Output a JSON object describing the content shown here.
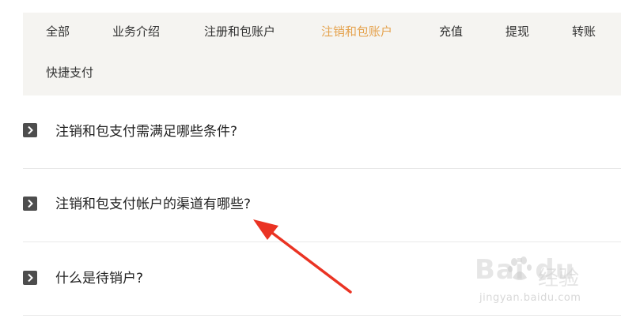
{
  "tabs": [
    {
      "label": "全部",
      "active": false
    },
    {
      "label": "业务介绍",
      "active": false
    },
    {
      "label": "注册和包账户",
      "active": false
    },
    {
      "label": "注销和包账户",
      "active": true
    },
    {
      "label": "充值",
      "active": false
    },
    {
      "label": "提现",
      "active": false
    },
    {
      "label": "转账",
      "active": false
    },
    {
      "label": "快捷支付",
      "active": false
    }
  ],
  "faq": [
    {
      "question": "注销和包支付需满足哪些条件?",
      "icon": "chevron-right-icon"
    },
    {
      "question": "注销和包支付帐户的渠道有哪些?",
      "icon": "chevron-right-icon"
    },
    {
      "question": "什么是待销户?",
      "icon": "chevron-right-icon"
    }
  ],
  "colors": {
    "active_tab": "#e5a34f",
    "tab_bar_bg": "#f5f4f1",
    "annotation_arrow": "#ea3323"
  },
  "watermark": {
    "logo_text": "Bai du",
    "jingyan": "经验",
    "url": "jingyan.baidu.com"
  }
}
